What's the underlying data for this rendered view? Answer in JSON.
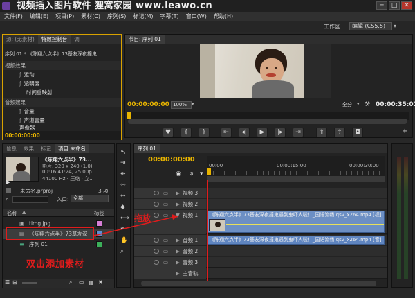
{
  "watermark": "视频插入图片软件 狸窝家园 www.leawo.cn",
  "window_controls": {
    "minimize": "─",
    "maximize": "□",
    "close": "✕"
  },
  "menu": [
    "文件(F)",
    "编辑(E)",
    "项目(P)",
    "素材(C)",
    "序列(S)",
    "标记(M)",
    "字幕(T)",
    "窗口(W)",
    "帮助(H)"
  ],
  "workspace": {
    "label": "工作区:",
    "value": "编辑 (CS5.5)"
  },
  "effect_controls": {
    "tabs": [
      "源: (无素材)",
      "特效控制台",
      "调"
    ],
    "clip_title": "序列 01 * 《陈翔六点半》73基友深夜撞鬼...",
    "video_effects_header": "视频效果",
    "effects": [
      "运动",
      "透明度",
      "时间重映射"
    ],
    "audio_effects_header": "音频效果",
    "audio_effects": [
      "音量",
      "声道音量",
      "声像器"
    ],
    "timecode": "00:00:00:00"
  },
  "program_monitor": {
    "tab": "节目: 序列 01",
    "timecode_left": "00:00:00:00",
    "zoom": "100%",
    "quality": "全分",
    "timecode_right": "00:00:35:01"
  },
  "project_panel": {
    "tabs": [
      "信息",
      "效果",
      "标记",
      "项目:未命名"
    ],
    "clip_name": "《陈翔六点半》73...",
    "clip_info1": "影片, 320 x 240 (1.0)",
    "clip_info2": "00:16:41:24, 25.00p",
    "clip_info3": "44100 Hz - 压缩 · 立...",
    "project_file": "未命名.prproj",
    "item_count": "3 项",
    "entry_label": "入口:",
    "entry_value": "全部",
    "col_name": "名称",
    "col_label": "标签",
    "items": [
      {
        "name": "timg.jpg",
        "color": "#d67ed6"
      },
      {
        "name": "《陈翔六点半》73基友深",
        "color": "#5b8fd6"
      },
      {
        "name": "序列 01",
        "color": "#3cb05a"
      }
    ]
  },
  "timeline": {
    "tab": "序列 01",
    "timecode": "00:00:00:00",
    "ruler": [
      "00:00",
      "00:00:15:00",
      "00:00:30:00"
    ],
    "video_tracks": [
      "视频 3",
      "视频 2",
      "视频 1"
    ],
    "audio_tracks": [
      "音频 1",
      "音频 2",
      "音频 3"
    ],
    "master": "主音轨",
    "clip_v2_label": "《陈翔六点半》73基友深夜撞鬼遇到鬼吓人啦！_国语流畅.qsv_x264.mp4 [视]",
    "clip_a1_label": "《陈翔六点半》73基友深夜撞鬼遇到鬼吓人啦！_国语流畅.qsv_x264.mp4 [音]"
  },
  "annotations": {
    "drag": "拖放",
    "double_click": "双击添加素材"
  },
  "colors": {
    "timecode": "#e8b400",
    "highlight": "#d9a200",
    "annotation": "#e01c1c",
    "clip": "#6c8fc4"
  }
}
